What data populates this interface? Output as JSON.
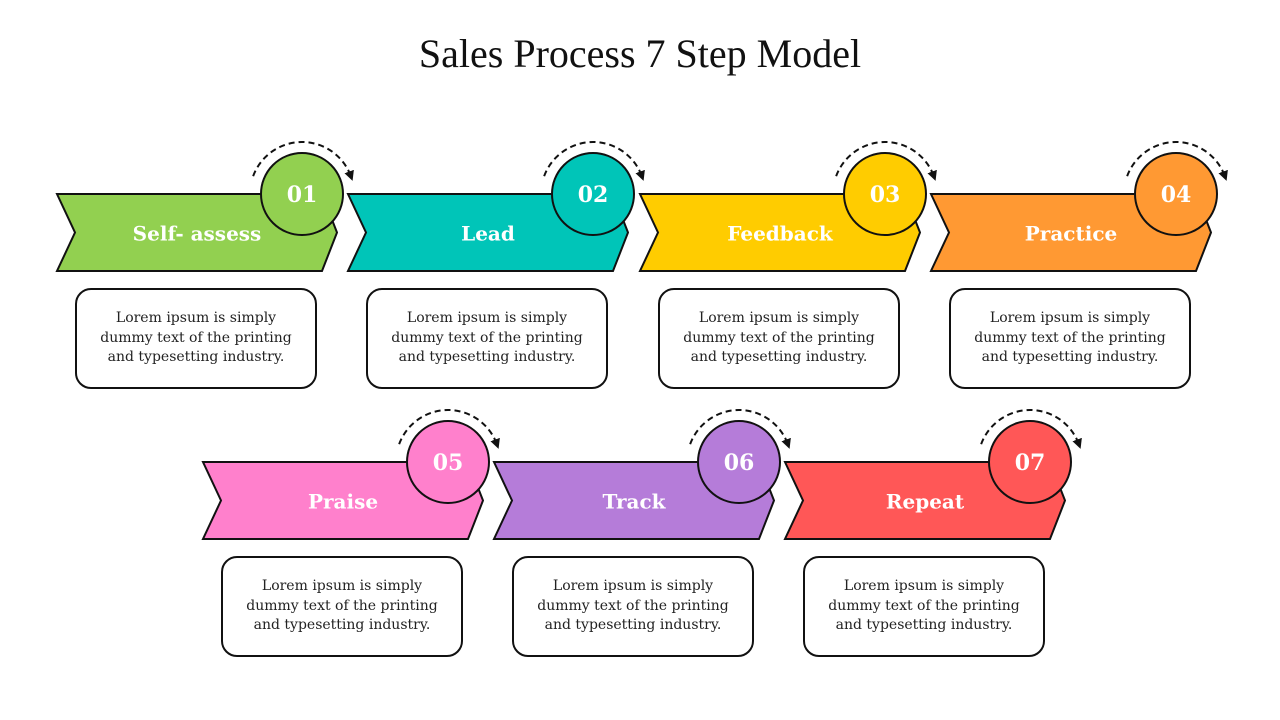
{
  "title": "Sales Process 7 Step Model",
  "steps": [
    {
      "number": "01",
      "label": "Self- assess",
      "color": "#92D050",
      "description": "Lorem ipsum is simply dummy text of the printing and typesetting industry."
    },
    {
      "number": "02",
      "label": "Lead",
      "color": "#00C5B8",
      "description": "Lorem ipsum is simply dummy text of the printing and typesetting industry."
    },
    {
      "number": "03",
      "label": "Feedback",
      "color": "#FFCC00",
      "description": "Lorem ipsum is simply dummy text of the printing and typesetting industry."
    },
    {
      "number": "04",
      "label": "Practice",
      "color": "#FF9933",
      "description": "Lorem ipsum is simply dummy text of the printing and typesetting industry."
    },
    {
      "number": "05",
      "label": "Praise",
      "color": "#FF80CC",
      "description": "Lorem ipsum is simply dummy text of the printing and typesetting industry."
    },
    {
      "number": "06",
      "label": "Track",
      "color": "#B57CD9",
      "description": "Lorem ipsum is simply dummy text of the printing and typesetting industry."
    },
    {
      "number": "07",
      "label": "Repeat",
      "color": "#FF5757",
      "description": "Lorem ipsum is simply dummy text of the printing and typesetting industry."
    }
  ]
}
